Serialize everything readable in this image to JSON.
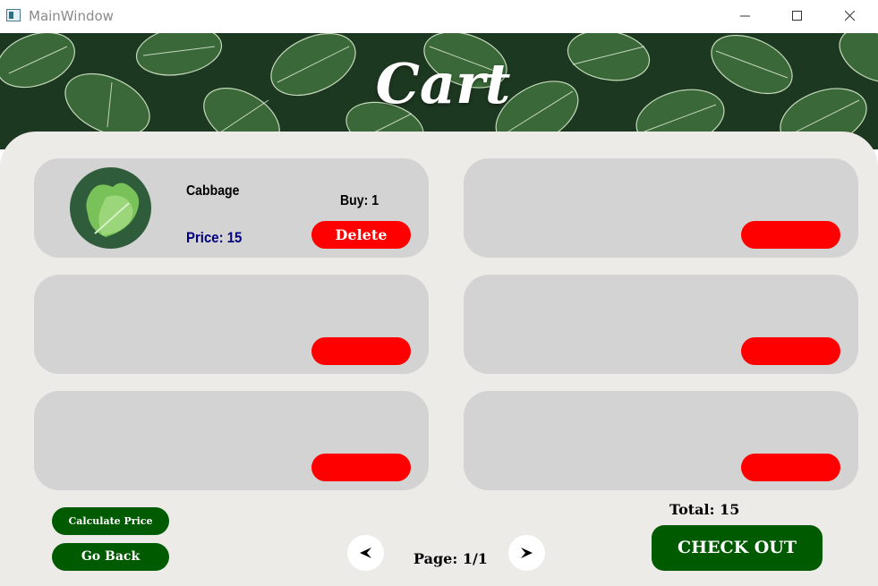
{
  "window": {
    "title": "MainWindow"
  },
  "header": {
    "title": "Cart"
  },
  "cart_items": [
    {
      "name": "Cabbage",
      "buy_text": "Buy: 1",
      "price_text": "Price: 15",
      "delete_label": "Delete",
      "icon": "lettuce-icon"
    },
    {
      "delete_label": ""
    },
    {
      "delete_label": ""
    },
    {
      "delete_label": ""
    },
    {
      "delete_label": ""
    },
    {
      "delete_label": ""
    }
  ],
  "footer": {
    "calculate_label": "Calculate Price",
    "go_back_label": "Go Back",
    "page_text": "Page: 1/1",
    "total_text": "Total: 15",
    "checkout_label": "CHECK OUT"
  },
  "colors": {
    "delete_button": "#ff0000",
    "green_button": "#005a00",
    "card_background": "#d3d3d3",
    "panel_background": "#ecebe8",
    "price_text": "#000080"
  }
}
